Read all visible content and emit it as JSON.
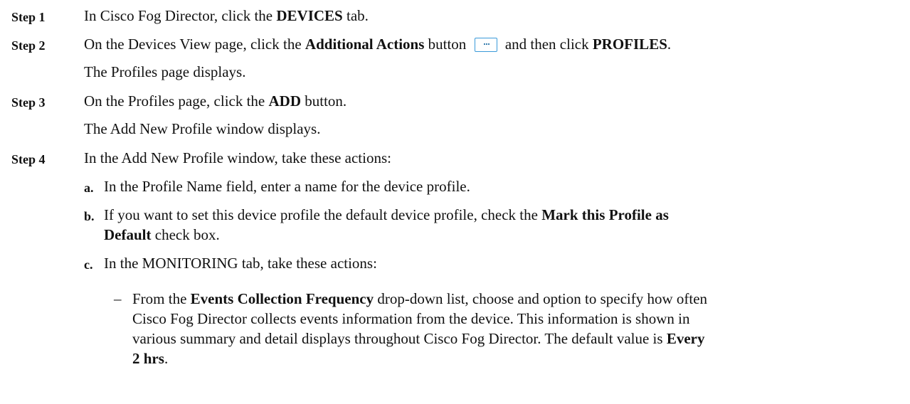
{
  "steps": [
    {
      "label": "Step 1",
      "line": {
        "pre": "In Cisco Fog Director, click the ",
        "b1": "DEVICES",
        "post": " tab."
      }
    },
    {
      "label": "Step 2",
      "line": {
        "pre": "On the Devices View page, click the ",
        "b1": "Additional Actions",
        "mid": " button ",
        "mid2": " and then click ",
        "b2": "PROFILES",
        "post": "."
      },
      "result": "The Profiles page displays."
    },
    {
      "label": "Step 3",
      "line": {
        "pre": "On the Profiles page, click the ",
        "b1": "ADD",
        "post": " button."
      },
      "result": "The Add New Profile window displays."
    },
    {
      "label": "Step 4",
      "line": {
        "text": "In the Add New Profile window, take these actions:"
      },
      "substeps": [
        {
          "letter": "a.",
          "text": "In the Profile Name field, enter a name for the device profile."
        },
        {
          "letter": "b.",
          "pre": "If you want to set this device profile the default device profile, check the ",
          "b1": "Mark this Profile as",
          "b1_line2": "Default",
          "post": " check box."
        },
        {
          "letter": "c.",
          "text": "In the MONITORING tab, take these actions:"
        }
      ],
      "bullet": {
        "dash": "–",
        "pre": "From the ",
        "b1": "Events Collection Frequency",
        "l1_post": " drop-down list, choose and option to specify how often",
        "l2": "Cisco Fog Director collects events information from the device. This information is shown in",
        "l3_pre": "various summary and detail displays throughout Cisco Fog Director. The default value is ",
        "b2": "Every",
        "b2_line2": "2 hrs",
        "post": "."
      }
    }
  ]
}
